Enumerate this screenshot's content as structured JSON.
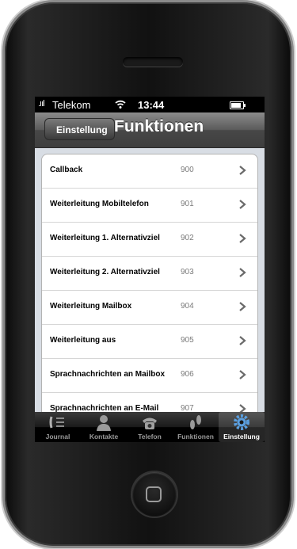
{
  "statusbar": {
    "signal": ".ııl",
    "carrier": "Telekom",
    "time": "13:44",
    "battery_level": 0.85
  },
  "navbar": {
    "back_label": "Einstellung",
    "title": "Funktionen"
  },
  "list": [
    {
      "label": "Callback",
      "code": "900"
    },
    {
      "label": "Weiterleitung Mobiltelefon",
      "code": "901"
    },
    {
      "label": "Weiterleitung 1. Alternativziel",
      "code": "902"
    },
    {
      "label": "Weiterleitung 2. Alternativziel",
      "code": "903"
    },
    {
      "label": "Weiterleitung Mailbox",
      "code": "904"
    },
    {
      "label": "Weiterleitung aus",
      "code": "905"
    },
    {
      "label": "Sprachnachrichten an Mailbox",
      "code": "906"
    },
    {
      "label": "Sprachnachrichten an E-Mail",
      "code": "907"
    }
  ],
  "tabs": [
    {
      "label": "Journal",
      "icon": "journal-icon"
    },
    {
      "label": "Kontakte",
      "icon": "contacts-icon"
    },
    {
      "label": "Telefon",
      "icon": "phone-icon"
    },
    {
      "label": "Funktionen",
      "icon": "footprints-icon"
    },
    {
      "label": "Einstellung",
      "icon": "gear-icon",
      "active": true
    }
  ],
  "colors": {
    "accent": "#5a9fe0",
    "navbar": "#4a4a4a"
  }
}
